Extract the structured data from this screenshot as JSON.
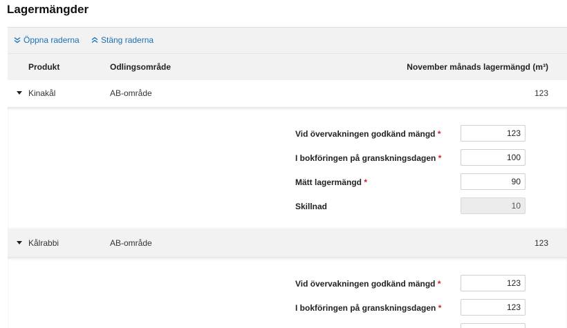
{
  "page": {
    "title": "Lagermängder"
  },
  "toolbar": {
    "expand_label": "Öppna raderna",
    "collapse_label": "Stäng raderna"
  },
  "columns": {
    "product": "Produkt",
    "area": "Odlingsområde",
    "amount": "November månads lagermängd (m³)"
  },
  "rows": [
    {
      "product": "Kinakål",
      "area": "AB-område",
      "amount": "123",
      "fields": {
        "approved_label": "Vid övervakningen godkänd mängd",
        "approved_value": "123",
        "booked_label": "I bokföringen på granskningsdagen",
        "booked_value": "100",
        "measured_label": "Mätt lagermängd",
        "measured_value": "90",
        "difference_label": "Skillnad",
        "difference_value": "10"
      }
    },
    {
      "product": "Kålrabbi",
      "area": "AB-område",
      "amount": "123",
      "fields": {
        "approved_label": "Vid övervakningen godkänd mängd",
        "approved_value": "123",
        "booked_label": "I bokföringen på granskningsdagen",
        "booked_value": "123"
      }
    }
  ],
  "required_marker": "*",
  "colors": {
    "link": "#1b6fb3",
    "required": "#d0202a",
    "panel_bg": "#f2f2f2"
  },
  "icons": {
    "expand": "double-chevron-down-icon",
    "collapse": "double-chevron-up-icon",
    "row_toggle": "caret-down-icon"
  }
}
